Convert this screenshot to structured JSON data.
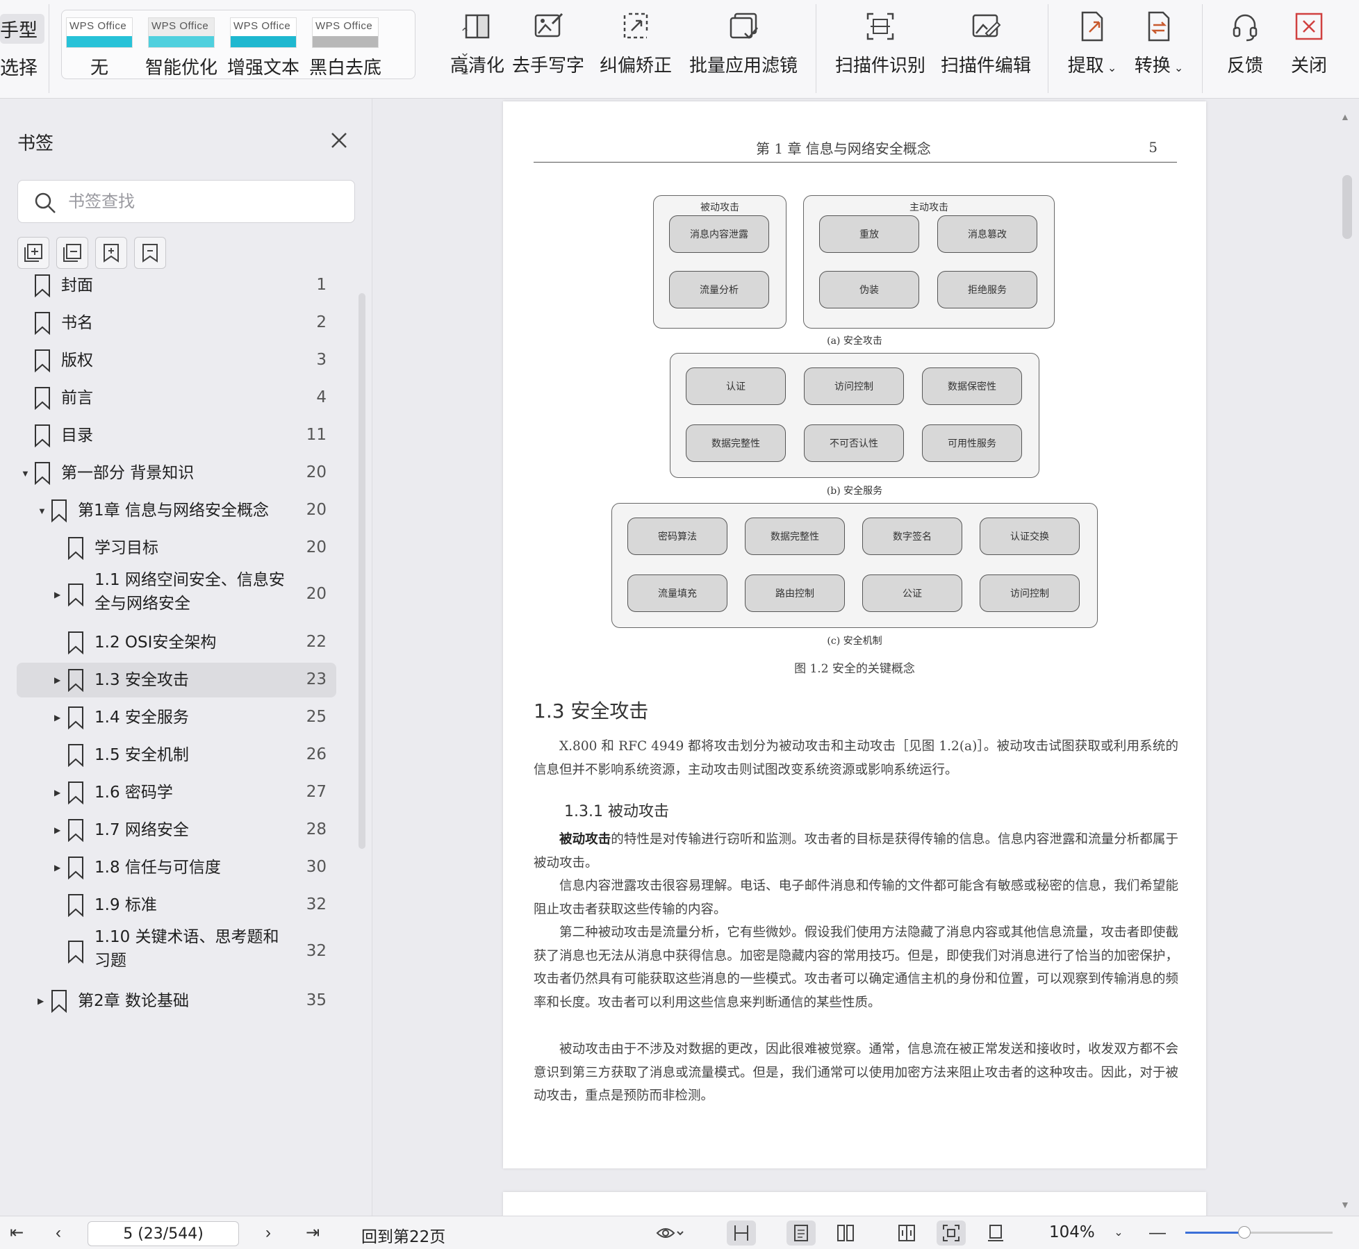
{
  "toolbar": {
    "left_partial": [
      "手型",
      "选择"
    ],
    "filters": [
      {
        "label": "无",
        "brand": "WPS Office",
        "band": "#27c2d8"
      },
      {
        "label": "智能优化",
        "brand": "WPS Office",
        "band": "#4fd0de"
      },
      {
        "label": "增强文本",
        "brand": "WPS Office",
        "band": "#1fb8d0"
      },
      {
        "label": "黑白去底",
        "brand": "WPS Office",
        "band": "#b8b8b8"
      }
    ],
    "tools": [
      {
        "label": "高清化",
        "icon": "hd-enhance-icon"
      },
      {
        "label": "去手写字",
        "icon": "remove-handwriting-icon"
      },
      {
        "label": "纠偏矫正",
        "icon": "deskew-correct-icon"
      },
      {
        "label": "批量应用滤镜",
        "icon": "batch-filter-icon"
      },
      {
        "label": "扫描件识别",
        "icon": "scan-recognize-icon"
      },
      {
        "label": "扫描件编辑",
        "icon": "scan-edit-icon"
      },
      {
        "label": "提取",
        "icon": "extract-icon"
      },
      {
        "label": "转换",
        "icon": "convert-icon"
      },
      {
        "label": "反馈",
        "icon": "headset-icon"
      },
      {
        "label": "关闭",
        "icon": "close-box-icon"
      }
    ]
  },
  "sidebar": {
    "title": "书签",
    "search_placeholder": "书签查找",
    "items": [
      {
        "label": "封面",
        "page": "1"
      },
      {
        "label": "书名",
        "page": "2"
      },
      {
        "label": "版权",
        "page": "3"
      },
      {
        "label": "前言",
        "page": "4"
      },
      {
        "label": "目录",
        "page": "11"
      },
      {
        "label": "第一部分  背景知识",
        "page": "20"
      },
      {
        "label": "第1章  信息与网络安全概念",
        "page": "20"
      },
      {
        "label": "学习目标",
        "page": "20"
      },
      {
        "label": "1.1  网络空间安全、信息安全与网络安全",
        "page": "20"
      },
      {
        "label": "1.2  OSI安全架构",
        "page": "22"
      },
      {
        "label": "1.3  安全攻击",
        "page": "23"
      },
      {
        "label": "1.4  安全服务",
        "page": "25"
      },
      {
        "label": "1.5  安全机制",
        "page": "26"
      },
      {
        "label": "1.6  密码学",
        "page": "27"
      },
      {
        "label": "1.7  网络安全",
        "page": "28"
      },
      {
        "label": "1.8  信任与可信度",
        "page": "30"
      },
      {
        "label": "1.9  标准",
        "page": "32"
      },
      {
        "label": "1.10  关键术语、思考题和习题",
        "page": "32"
      },
      {
        "label": "第2章  数论基础",
        "page": "35"
      }
    ]
  },
  "document": {
    "header_chapter": "第 1 章    信息与网络安全概念",
    "header_page": "5",
    "figure": {
      "a_passive_title": "被动攻击",
      "a_active_title": "主动攻击",
      "a_passive": [
        "消息内容泄露",
        "流量分析"
      ],
      "a_active": [
        "重放",
        "消息篡改",
        "伪装",
        "拒绝服务"
      ],
      "a_caption": "(a) 安全攻击",
      "b_items": [
        "认证",
        "访问控制",
        "数据保密性",
        "数据完整性",
        "不可否认性",
        "可用性服务"
      ],
      "b_caption": "(b) 安全服务",
      "c_items": [
        "密码算法",
        "数据完整性",
        "数字签名",
        "认证交换",
        "流量填充",
        "路由控制",
        "公证",
        "访问控制"
      ],
      "c_caption": "(c) 安全机制",
      "caption": "图 1.2    安全的关键概念"
    },
    "section_title": "1.3    安全攻击",
    "section_para": "X.800 和 RFC 4949 都将攻击划分为被动攻击和主动攻击［见图 1.2(a)］。被动攻击试图获取或利用系统的信息但并不影响系统资源，主动攻击则试图改变系统资源或影响系统运行。",
    "subsection_title": "1.3.1    被动攻击",
    "para1_bold": "被动攻击",
    "para1_rest": "的特性是对传输进行窃听和监测。攻击者的目标是获得传输的信息。信息内容泄露和流量分析都属于被动攻击。",
    "para2": "信息内容泄露攻击很容易理解。电话、电子邮件消息和传输的文件都可能含有敏感或秘密的信息，我们希望能阻止攻击者获取这些传输的内容。",
    "para3": "第二种被动攻击是流量分析，它有些微妙。假设我们使用方法隐藏了消息内容或其他信息流量，攻击者即使截获了消息也无法从消息中获得信息。加密是隐藏内容的常用技巧。但是，即使我们对消息进行了恰当的加密保护，攻击者仍然具有可能获取这些消息的一些模式。攻击者可以确定通信主机的身份和位置，可以观察到传输消息的频率和长度。攻击者可以利用这些信息来判断通信的某些性质。",
    "para4": "被动攻击由于不涉及对数据的更改，因此很难被觉察。通常，信息流在被正常发送和接收时，收发双方都不会意识到第三方获取了消息或流量模式。但是，我们通常可以使用加密方法来阻止攻击者的这种攻击。因此，对于被动攻击，重点是预防而非检测。"
  },
  "statusbar": {
    "page_indicator": "5 (23/544)",
    "back_label": "回到第22页",
    "zoom": "104%",
    "zoom_level": 0.4
  }
}
